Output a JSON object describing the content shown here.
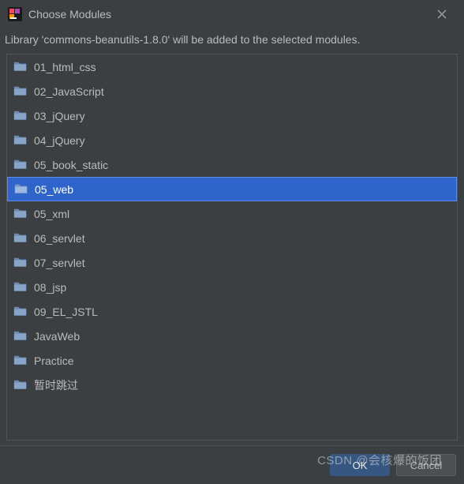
{
  "titlebar": {
    "title": "Choose Modules"
  },
  "info_text": "Library 'commons-beanutils-1.8.0' will be added to the selected modules.",
  "modules": [
    {
      "label": "01_html_css",
      "selected": false
    },
    {
      "label": "02_JavaScript",
      "selected": false
    },
    {
      "label": "03_jQuery",
      "selected": false
    },
    {
      "label": "04_jQuery",
      "selected": false
    },
    {
      "label": "05_book_static",
      "selected": false
    },
    {
      "label": "05_web",
      "selected": true
    },
    {
      "label": "05_xml",
      "selected": false
    },
    {
      "label": "06_servlet",
      "selected": false
    },
    {
      "label": "07_servlet",
      "selected": false
    },
    {
      "label": "08_jsp",
      "selected": false
    },
    {
      "label": "09_EL_JSTL",
      "selected": false
    },
    {
      "label": "JavaWeb",
      "selected": false
    },
    {
      "label": "Practice",
      "selected": false
    },
    {
      "label": "暂时跳过",
      "selected": false
    }
  ],
  "buttons": {
    "ok": "OK",
    "cancel": "Cancel"
  },
  "watermark": "CSDN @会核爆的饭团"
}
